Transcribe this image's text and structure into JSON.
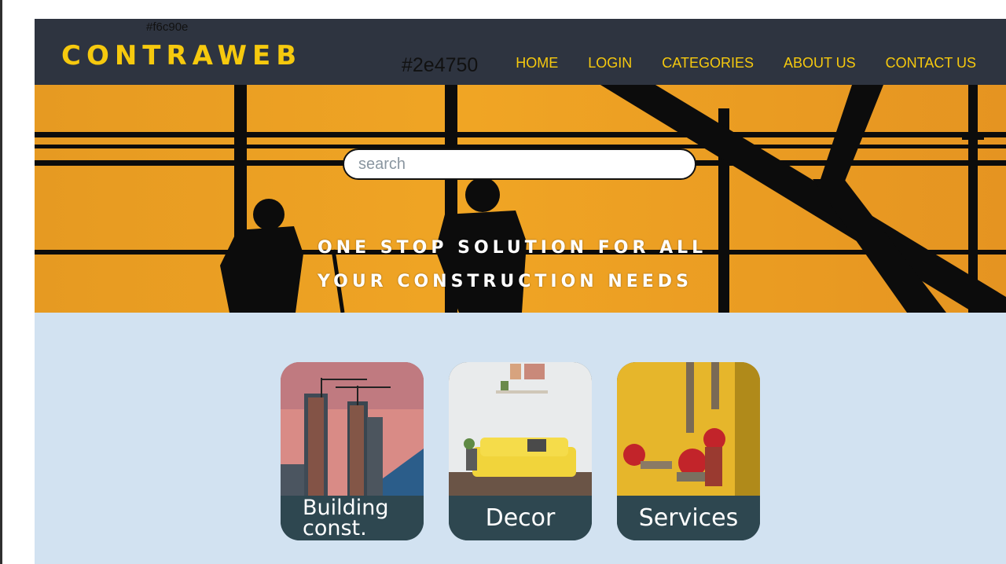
{
  "annotations": {
    "yellow_hex": "#f6c90e",
    "dark_hex": "#2e4750"
  },
  "colors": {
    "brand_yellow": "#f6c90e",
    "navbar_bg": "#2e3440",
    "card_label_bg": "#2e4750",
    "content_bg": "#d2e2f1",
    "hero_orange": "#f0a524"
  },
  "header": {
    "logo": "CONTRAWEB",
    "nav": [
      "HOME",
      "LOGIN",
      "CATEGORIES",
      "ABOUT US",
      "CONTACT US"
    ]
  },
  "hero": {
    "search_placeholder": "search",
    "tagline_line1": "ONE STOP SOLUTION FOR ALL",
    "tagline_line2": "YOUR CONSTRUCTION NEEDS"
  },
  "categories": [
    {
      "label": "Building const."
    },
    {
      "label": "Decor"
    },
    {
      "label": "Services"
    }
  ]
}
